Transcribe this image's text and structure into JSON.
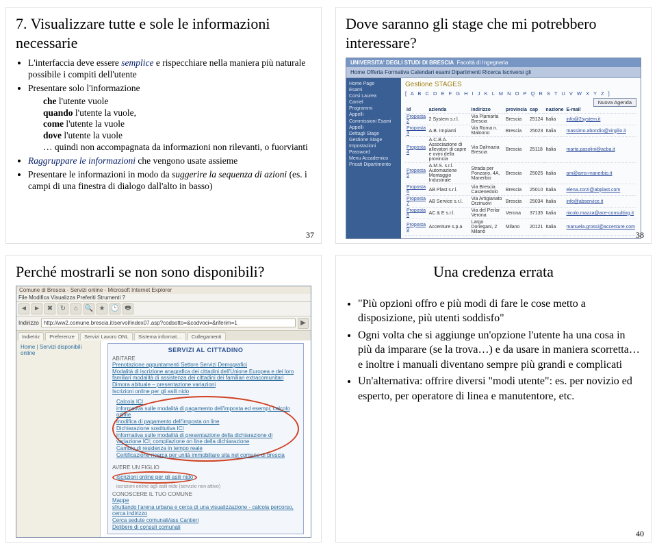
{
  "slide37": {
    "title": "7. Visualizzare tutte e sole le informazioni necessarie",
    "b1_pre": "L'interfaccia deve essere ",
    "b1_em": "semplice",
    "b1_post": " e rispecchiare nella maniera più naturale possibile i compiti dell'utente",
    "b2": "Presentare solo l'informazione",
    "b2a_pre": "che ",
    "b2a_post": "l'utente vuole",
    "b2b_pre": "quando ",
    "b2b_post": "l'utente la vuole,",
    "b2c_pre": "come ",
    "b2c_post": "l'utente la vuole",
    "b2d_pre": "dove ",
    "b2d_post": "l'utente la vuole",
    "b2e": "… quindi non accompagnata da informazioni non rilevanti, o fuorvianti",
    "b3_pre": "Raggruppare le informazioni",
    "b3_post": " che vengono usate assieme",
    "b4_pre": "Presentare le informazioni in modo da ",
    "b4_em": "suggerire la sequenza di azioni",
    "b4_post": " (es. i campi di una finestra di dialogo dall'alto in basso)",
    "num": "37"
  },
  "slide38": {
    "title": "Dove saranno gli stage che mi potrebbero interessare?",
    "header1": "UNIVERSITA' DEGLI STUDI DI BRESCIA",
    "header1sub": "Facoltà di Ingegneria",
    "nav": "Home   Offerta Formativa   Calendari esami   Dipartimenti   Ricerca   Iscriversi gli",
    "side_items": [
      "Home Page",
      "Esami",
      "Corsi Laurea",
      "Carriel",
      "Programmi",
      "Appelli",
      "Commissioni Esami",
      "Appelli",
      "Dettagli Stage",
      "Gestione Stage",
      "",
      "Impostazioni",
      "Password",
      "",
      "Menu Accademico",
      "Pricati Dipartimento"
    ],
    "gestione": "Gestione STAGES",
    "letters": "[ A  B  C  D  E  F  G  H  I  J  K  L  M  N  O  P  Q  R  S  T  U  V  W  X  Y  Z ]",
    "button": "Nuova Agenda",
    "cols": [
      "id",
      "azienda",
      "indirizzo",
      "provincia",
      "cap",
      "nazione",
      "E-mail"
    ],
    "rows": [
      {
        "id": "Proposta 2",
        "az": "2 System s.r.l.",
        "addr": "Via Piamarta Brescia",
        "prov": "Brescia",
        "cap": "25124",
        "naz": "Italia",
        "email": "info@2system.it"
      },
      {
        "id": "Proposta 3",
        "az": "A.B. Impianti",
        "addr": "Via Roma n. Malonno",
        "prov": "Brescia",
        "cap": "25023",
        "naz": "Italia",
        "email": "massimo.abondio@virgilio.it"
      },
      {
        "id": "Proposta 4",
        "az": "A.C.B.A. Associazione di allevatori di capre e ovini della provincia",
        "addr": "Via Dalmazia Brescia",
        "prov": "Brescia",
        "cap": "25118",
        "naz": "Italia",
        "email": "marta.pasolini@acba.it"
      },
      {
        "id": "Proposta 5",
        "az": "A.M.S. s.r.l. Automazione Montaggio Industriale",
        "addr": "Strada per Ponzano, 4A, Manerbio",
        "prov": "Brescia",
        "cap": "25025",
        "naz": "Italia",
        "email": "am@ams-manerbio.it"
      },
      {
        "id": "Proposta 6",
        "az": "AB Plast s.r.l.",
        "addr": "Via Brescia Castenedolo",
        "prov": "Brescia",
        "cap": "25010",
        "naz": "Italia",
        "email": "elena.zorzi@abplast.com"
      },
      {
        "id": "Proposta 7",
        "az": "AB Service s.r.l.",
        "addr": "Via Artigianato Orzinuovi",
        "prov": "Brescia",
        "cap": "25034",
        "naz": "Italia",
        "email": "info@abservice.it"
      },
      {
        "id": "Proposta 8",
        "az": "AC & E s.r.l.",
        "addr": "Via del Perlar Verona",
        "prov": "Verona",
        "cap": "37135",
        "naz": "Italia",
        "email": "nicolo.mazza@ace-consulting.it"
      },
      {
        "id": "Proposta 9",
        "az": "Accenture s.p.a",
        "addr": "Largo Donegani, 2 Milano",
        "prov": "Milano",
        "cap": "20121",
        "naz": "Italia",
        "email": "manuela.grossi@accenture.com"
      }
    ],
    "num": "38"
  },
  "slide39": {
    "title": "Perché mostrarli se non sono disponibili?",
    "winTitle": "Comune di Brescia - Servizi online - Microsoft Internet Explorer",
    "menubar": "File  Modifica  Visualizza  Preferiti  Strumenti  ?",
    "address_label": "Indirizzo",
    "addr": "http://ww2.comune.brescia.it/servol/index07.asp?codsotto=&codvoci=&riferim=1",
    "tabs": [
      "Indietriz",
      "Preferenze",
      "Servizi Lavoro ONL",
      "Sistema informat…",
      "Collegamenti"
    ],
    "lmenu": [
      "Home | Servizi disponibili online",
      "",
      "",
      "",
      "",
      ""
    ],
    "panel_title": "SERVIZI AL CITTADINO",
    "grp1": "ABITARE",
    "grp1_items": [
      "Prenotazione appuntamenti Settore Servizi Demografici",
      "Modalità di iscrizione anagrafica dei cittadini dell'Unione Europea e dei loro familiari modalità di assistenza dei cittadini dei familiari extracomunitari",
      "Dimora abituale – presentazione variazioni",
      "Iscrizioni online per gli asili nido"
    ],
    "circled": [
      "Calcola ICI",
      "informativa sulle modalità di pagamento dell'imposta ed esempi; calcolo online",
      "modifica di pagamento dell'imposta on line",
      "Dichiarazione sostitutiva ICI",
      "informativa sulle modalità di presentazione della dichiarazione di variazione ICI; compilazione on line della dichiarazione",
      "Cambio di residenza in tempo reale",
      "Certificazione ricerca per unità immobiliare sita nel comune di brescia"
    ],
    "grp2": "AVERE UN FIGLIO",
    "grp2_link": "Iscrizioni online per gli asili nido",
    "grp2_sub": "iscrizioni online agli asili nido (servizio non attivo)",
    "grp3": "CONOSCERE IL TUO COMUNE",
    "grp3_items": [
      "Mappe",
      "sfruttando l'arena urbana e cerca di una visualizzazione - calcola percorso, cerca indirizzo",
      "Cerca sedute comunali/ass Cantieri",
      "Delibere di consuli comunali"
    ]
  },
  "slide40": {
    "title": "Una credenza errata",
    "b1": "\"Più opzioni offro e più modi di fare le cose metto a disposizione, più utenti soddisfo\"",
    "b2": "Ogni volta che si aggiunge un'opzione l'utente ha una cosa in più da imparare (se la trova…) e da usare in maniera scorretta… e inoltre i manuali diventano sempre più grandi e complicati",
    "b3": "Un'alternativa: offrire diversi \"modi utente\": es. per novizio ed esperto, per operatore di linea e manutentore, etc.",
    "num": "40"
  }
}
